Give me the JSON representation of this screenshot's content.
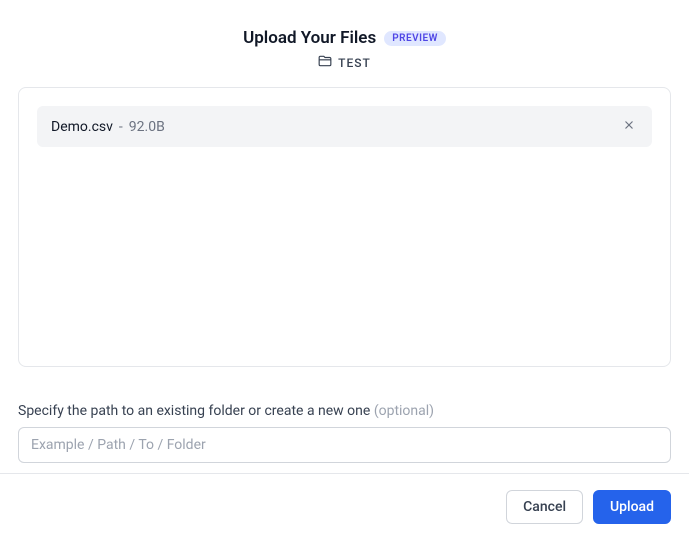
{
  "header": {
    "title": "Upload Your Files",
    "badge": "PREVIEW",
    "subtitle": "TEST"
  },
  "files": [
    {
      "name": "Demo.csv",
      "separator": "-",
      "size": "92.0B"
    }
  ],
  "path": {
    "label": "Specify the path to an existing folder or create a new one",
    "optional": "(optional)",
    "placeholder": "Example / Path / To / Folder",
    "value": ""
  },
  "footer": {
    "cancel": "Cancel",
    "upload": "Upload"
  }
}
